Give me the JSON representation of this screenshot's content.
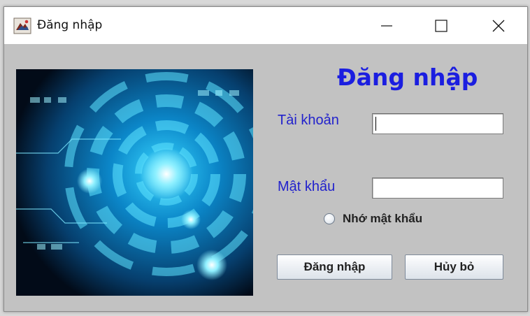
{
  "window": {
    "title": "Đăng nhập",
    "app_icon": "java-cup-icon",
    "controls": {
      "minimize": "minimize-icon",
      "maximize": "maximize-icon",
      "close": "close-icon"
    }
  },
  "form": {
    "heading": "Đăng nhập",
    "username_label": "Tài khoản",
    "username_value": "",
    "password_label": "Mật khẩu",
    "password_value": "",
    "remember_label": "Nhớ mật khẩu",
    "remember_checked": false,
    "login_button": "Đăng nhập",
    "cancel_button": "Hủy bỏ"
  },
  "image": {
    "subject": "blue digital circular tech graphic"
  },
  "colors": {
    "heading": "#1b1ee0",
    "labels": "#2222cc",
    "panel_bg": "#c2c2c2"
  }
}
